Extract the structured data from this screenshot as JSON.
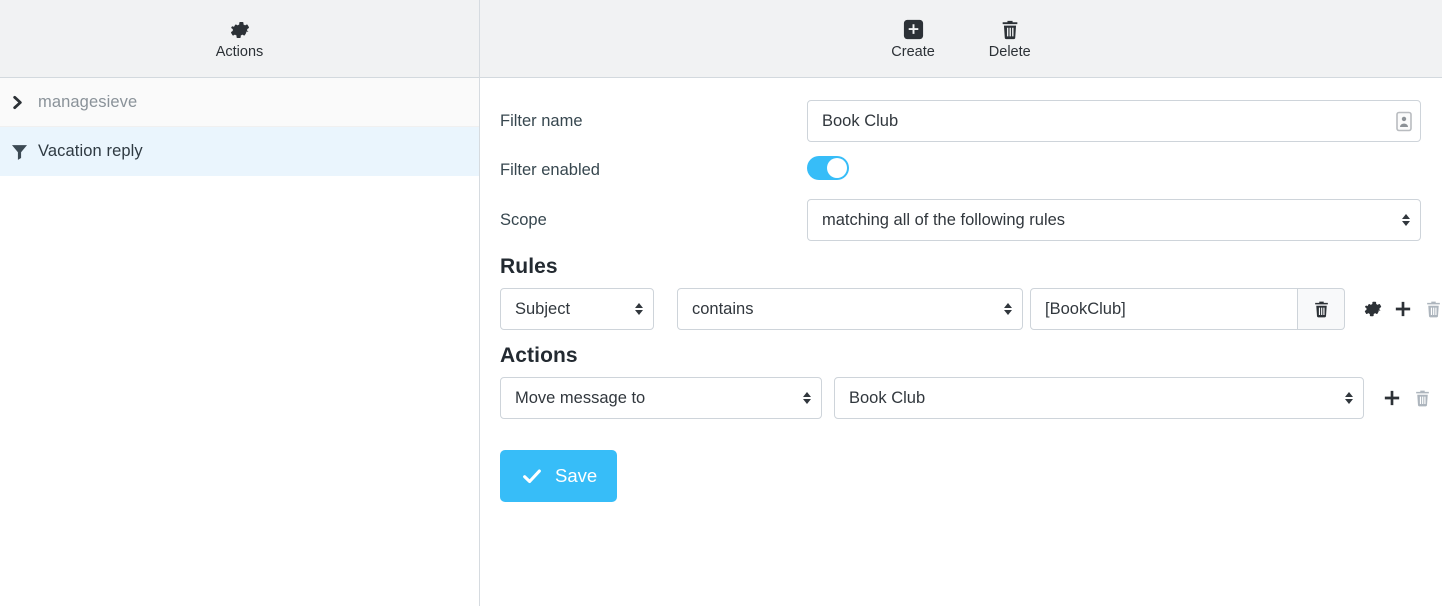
{
  "sidebar": {
    "header": {
      "actions_label": "Actions",
      "actions_icon": "gear-icon"
    },
    "items": [
      {
        "label": "managesieve",
        "icon": "chevron-right-icon",
        "type": "group",
        "selected": false
      },
      {
        "label": "Vacation reply",
        "icon": "filter-funnel-icon",
        "type": "filter",
        "selected": true
      }
    ]
  },
  "main": {
    "header": {
      "create_label": "Create",
      "create_icon": "plus-square-icon",
      "delete_label": "Delete",
      "delete_icon": "trash-icon"
    },
    "form": {
      "filter_name_label": "Filter name",
      "filter_name_value": "Book Club",
      "filter_name_placeholder": "",
      "filter_name_icon": "contact-card-icon",
      "filter_enabled_label": "Filter enabled",
      "filter_enabled_state": "on",
      "scope_label": "Scope",
      "scope_value": "matching all of the following rules"
    },
    "rules": {
      "title": "Rules",
      "row": {
        "field": "Subject",
        "operator": "contains",
        "value": "[BookClub]",
        "delete_icon": "trash-icon",
        "settings_icon": "gear-icon",
        "add_icon": "plus-icon",
        "remove_icon": "trash-icon-disabled"
      }
    },
    "actions": {
      "title": "Actions",
      "row": {
        "action": "Move message to",
        "target": "Book Club",
        "add_icon": "plus-icon",
        "remove_icon": "trash-icon-disabled"
      }
    },
    "save": {
      "label": "Save",
      "icon": "check-icon"
    }
  },
  "colors": {
    "accent": "#37bdf8",
    "header_bg": "#f1f2f3",
    "selected_row": "#eaf5fd",
    "label_text": "#37474f"
  }
}
